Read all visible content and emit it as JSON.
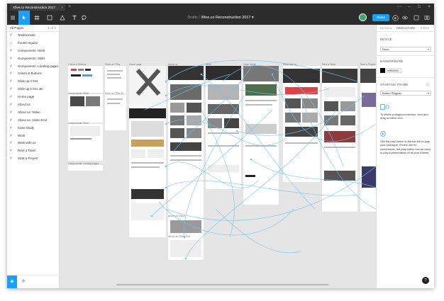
{
  "window": {
    "tab_title": "Xfive.co Reconstruction 2017",
    "tab_close": "×",
    "new_tab": "+"
  },
  "window_controls": {
    "menu": "⋯",
    "minimize": "–",
    "maximize": "□",
    "close": "×"
  },
  "toolbar": {
    "breadcrumb_folder": "Drafts",
    "breadcrumb_sep": "/",
    "file_name": "Xfive.co Reconstruction 2017",
    "file_caret": "▾",
    "share_label": "Share"
  },
  "pages_panel": {
    "title": "All Pages",
    "count": "1 of 1",
    "layers": [
      {
        "label": "Testimonials",
        "icon": "frame-icon"
      },
      {
        "label": "Footer regular",
        "icon": "component-icon"
      },
      {
        "label": "Components: Work",
        "icon": "frame-icon"
      },
      {
        "label": "Components: Skills",
        "icon": "frame-icon"
      },
      {
        "label": "Components: Landing pages",
        "icon": "frame-icon"
      },
      {
        "label": "Colors & Buttons",
        "icon": "frame-icon"
      },
      {
        "label": "Slide up CTAs",
        "icon": "frame-icon"
      },
      {
        "label": "Slide up CTAs 4K",
        "icon": "frame-icon"
      },
      {
        "label": "Home page",
        "icon": "frame-icon"
      },
      {
        "label": "About us",
        "icon": "frame-icon"
      },
      {
        "label": "About us: Video",
        "icon": "frame-icon"
      },
      {
        "label": "About us: Video End",
        "icon": "frame-icon"
      },
      {
        "label": "Case Study",
        "icon": "frame-icon"
      },
      {
        "label": "Work",
        "icon": "frame-icon"
      },
      {
        "label": "Work with us",
        "icon": "frame-icon"
      },
      {
        "label": "Rent a Team",
        "icon": "frame-icon"
      },
      {
        "label": "Start a Project",
        "icon": "frame-icon"
      }
    ]
  },
  "props_panel": {
    "tabs": [
      "DESIGN",
      "PROTOTYPE",
      "CODE"
    ],
    "active_tab": "PROTOTYPE",
    "device_label": "DEVICE",
    "device_value": "None",
    "background_label": "BACKGROUND",
    "background_hex": "#000000",
    "starting_frame_label": "STARTING FRAME",
    "starting_frame_value": "Button Regular",
    "help_delete": "To delete a single connection, click and drag on either end.",
    "help_play": "Use the play button in the top bar to play your prototype. If there are no connections, the play button can be used to play a presentation of all your frames."
  },
  "canvas_labels": {
    "colors_buttons": "Colors & Buttons",
    "slide_up": "Slide up CTAs",
    "home": "Home page",
    "about": "About us",
    "work": "Work",
    "case_study": "Case Study",
    "work_with_us": "Work with us",
    "rent_team": "Rent a Team",
    "start_project": "Start a Project",
    "comp_skills": "Components: Skills",
    "comp_work": "Components: Work",
    "comp_landing": "Components: Landing pages",
    "slide_up_4k": "Slide up CTAs 4K",
    "about_video": "About us: Video",
    "about_video_end": "About us: Video End"
  },
  "colors": {
    "accent": "#18a0fb",
    "toolbar": "#2c2c2c",
    "canvas": "#e5e5e5",
    "connection": "#6ec6f0"
  },
  "help_button": "?"
}
